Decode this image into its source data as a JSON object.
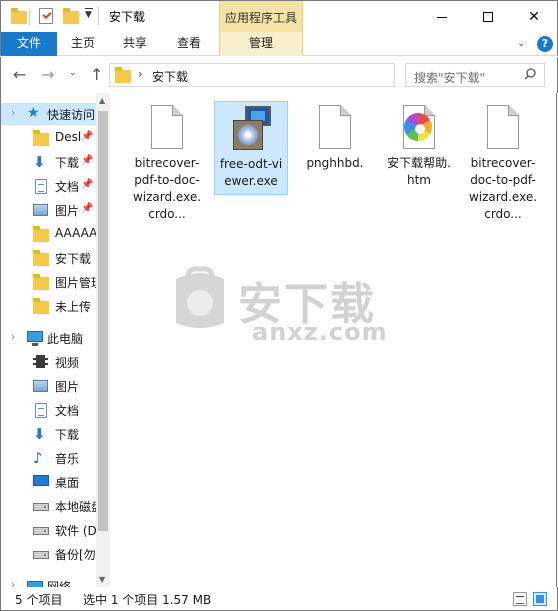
{
  "window": {
    "title": "安下载",
    "context_tab_group": "应用程序工具"
  },
  "ribbon": {
    "tabs": [
      "文件",
      "主页",
      "共享",
      "查看",
      "管理"
    ]
  },
  "address": {
    "path": "安下载",
    "search_placeholder": "搜索\"安下载\""
  },
  "nav_pane": {
    "quick_access": "快速访问",
    "pinned": [
      {
        "label": "Desl",
        "icon": "folder-icon"
      },
      {
        "label": "下载",
        "icon": "download-arrow-icon"
      },
      {
        "label": "文档",
        "icon": "document-icon"
      },
      {
        "label": "图片",
        "icon": "picture-icon"
      }
    ],
    "recent": [
      {
        "label": "AAAAA",
        "icon": "folder-icon"
      },
      {
        "label": "安下载",
        "icon": "folder-icon"
      },
      {
        "label": "图片管理",
        "icon": "folder-icon"
      },
      {
        "label": "未上传",
        "icon": "folder-icon"
      }
    ],
    "this_pc": "此电脑",
    "pc_items": [
      {
        "label": "视频",
        "icon": "video-icon"
      },
      {
        "label": "图片",
        "icon": "picture-icon"
      },
      {
        "label": "文档",
        "icon": "document-icon"
      },
      {
        "label": "下载",
        "icon": "download-arrow-icon"
      },
      {
        "label": "音乐",
        "icon": "music-icon"
      },
      {
        "label": "桌面",
        "icon": "desktop-icon"
      },
      {
        "label": "本地磁盘",
        "icon": "drive-icon"
      },
      {
        "label": "软件 (D",
        "icon": "drive-icon"
      },
      {
        "label": "备份[勿",
        "icon": "drive-icon"
      }
    ],
    "network": "网络"
  },
  "files": [
    {
      "name": "bitrecover-pdf-to-doc-wizard.exe.crdo...",
      "type": "blank"
    },
    {
      "name": "free-odt-viewer.exe",
      "type": "installer",
      "selected": true
    },
    {
      "name": "pnghhbd.",
      "type": "blank"
    },
    {
      "name": "安下载帮助.htm",
      "type": "browser"
    },
    {
      "name": "bitrecover-doc-to-pdf-wizard.exe.crdo...",
      "type": "blank"
    }
  ],
  "watermark": {
    "text": "安下载",
    "sub": "anxz.com"
  },
  "status": {
    "count": "5 个项目",
    "selected": "选中 1 个项目  1.57 MB"
  }
}
